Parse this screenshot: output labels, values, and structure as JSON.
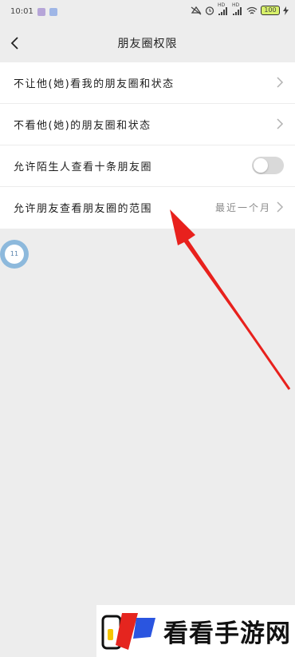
{
  "status_bar": {
    "time": "10:01",
    "hd_label": "HD",
    "battery": "100",
    "colors": {
      "app_indicator": "#b6a5d8",
      "battery_fill": "#d7f06a"
    }
  },
  "header": {
    "title": "朋友圈权限",
    "back_icon": "chevron-left-icon"
  },
  "settings": {
    "items": [
      {
        "label": "不让他(她)看我的朋友圈和状态",
        "control": "chevron"
      },
      {
        "label": "不看他(她)的朋友圈和状态",
        "control": "chevron"
      },
      {
        "label": "允许陌生人查看十条朋友圈",
        "control": "toggle",
        "toggle_on": false
      },
      {
        "label": "允许朋友查看朋友圈的范围",
        "value": "最近一个月",
        "control": "chevron"
      }
    ]
  },
  "floating_ball": {
    "badge": "11"
  },
  "annotation": {
    "arrow_color": "#e8211d"
  },
  "watermark": {
    "text": "看看手游网",
    "colors": {
      "red": "#e5251f",
      "blue": "#2a55e0",
      "yellow": "#f5c400"
    }
  }
}
